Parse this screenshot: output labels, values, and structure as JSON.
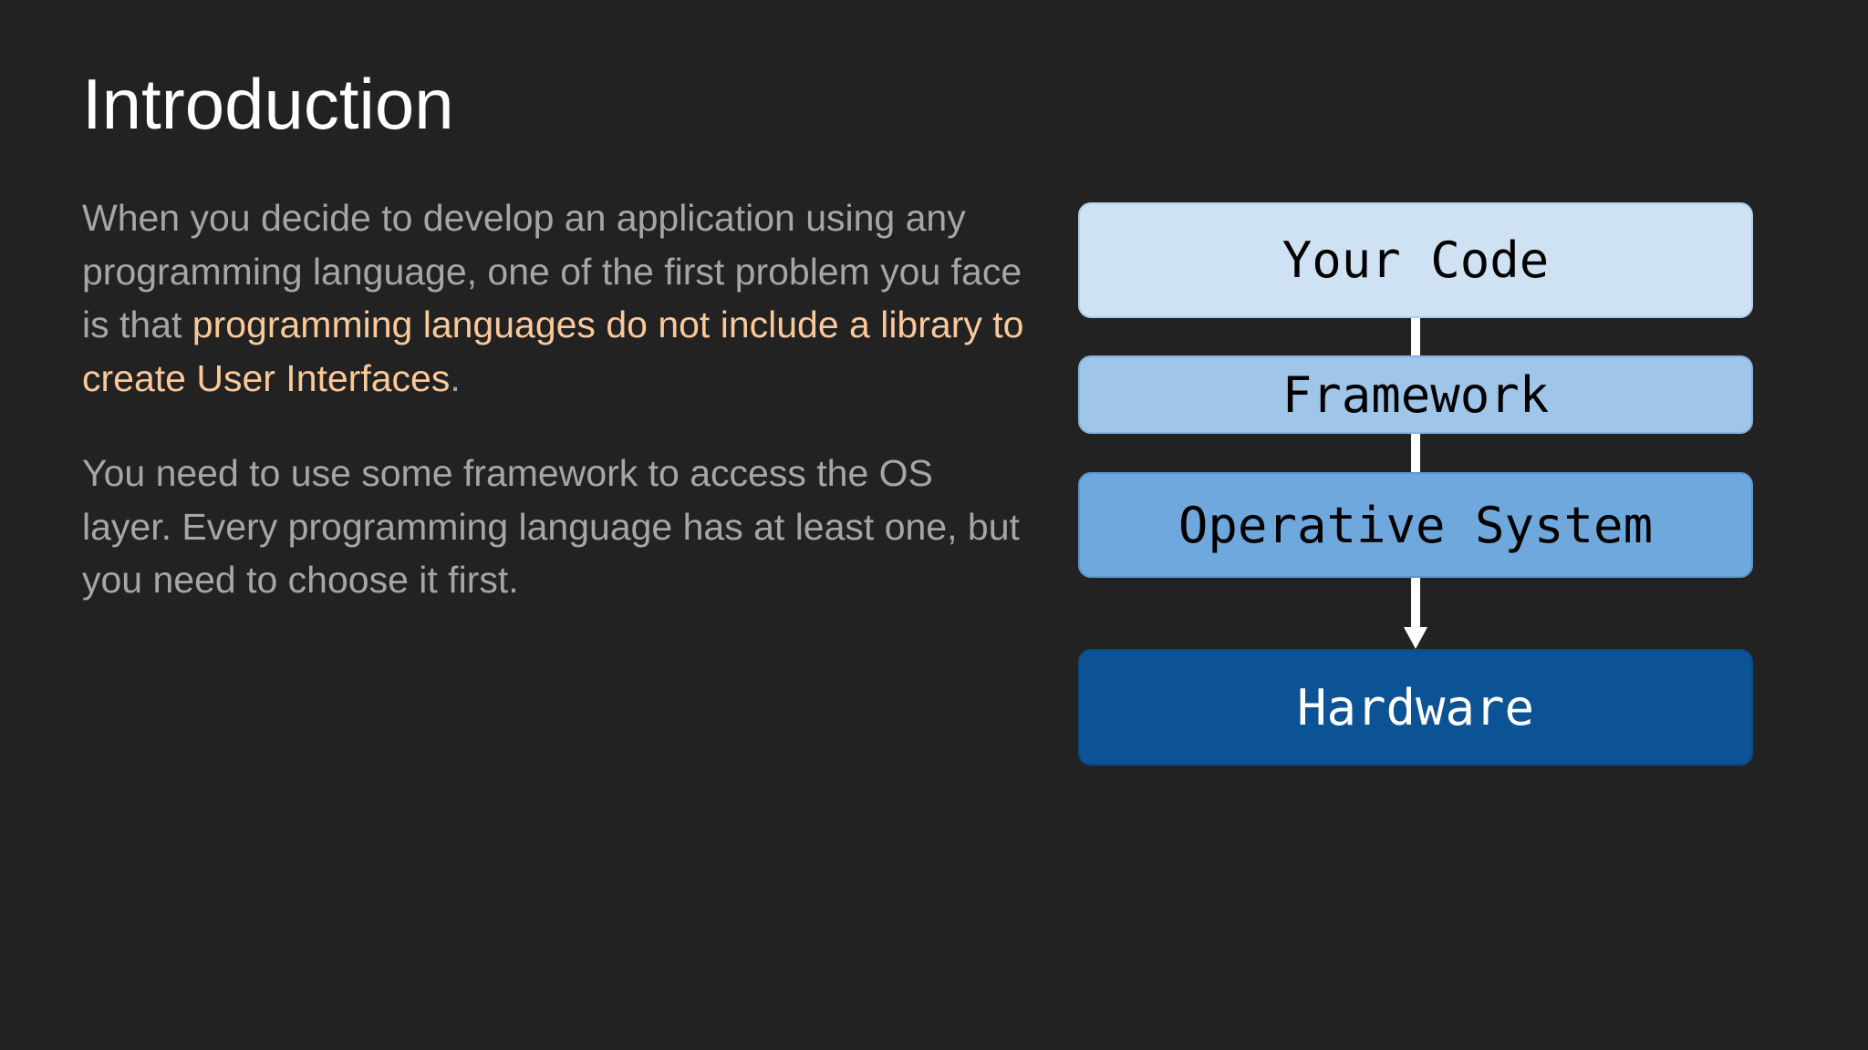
{
  "slide": {
    "title": "Introduction",
    "paragraph1": {
      "before": "When you decide to develop an application using any programming language, one of the first problem you face is that ",
      "highlight": "programming languages do not include a library to create User Interfaces",
      "after": "."
    },
    "paragraph2": "You need to use some framework to access the OS layer. Every programming language has at least one, but you need to choose it first."
  },
  "diagram": {
    "layers": [
      {
        "label": "Your Code",
        "color": "#cfe2f3"
      },
      {
        "label": "Framework",
        "color": "#9fc5e8"
      },
      {
        "label": "Operative System",
        "color": "#6fa8dc"
      },
      {
        "label": "Hardware",
        "color": "#0b5394"
      }
    ]
  },
  "colors": {
    "background": "#222222",
    "title": "#ffffff",
    "body_text": "#a6a6a6",
    "highlight": "#fbc89a",
    "connector": "#ffffff"
  }
}
